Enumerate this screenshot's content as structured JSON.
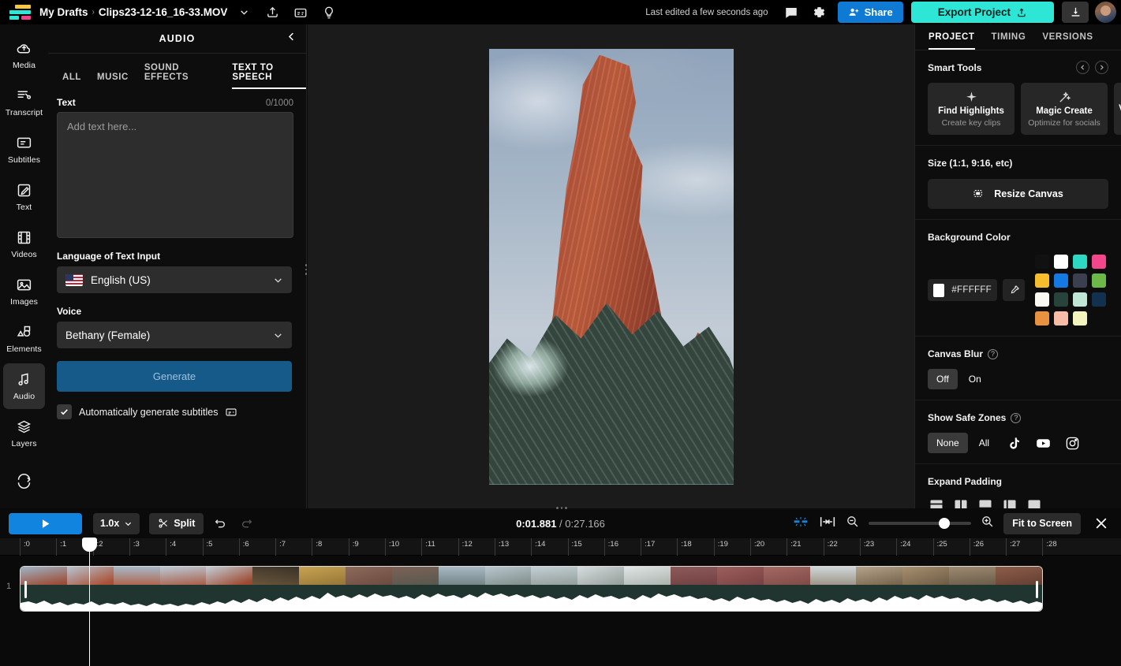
{
  "topbar": {
    "workspace": "My Drafts",
    "separator": "›",
    "filename": "Clips23-12-16_16-33.MOV",
    "last_edited": "Last edited a few seconds ago",
    "share_label": "Share",
    "export_label": "Export Project"
  },
  "rail": {
    "items": [
      {
        "label": "Media",
        "icon": "cloud-upload-icon",
        "active": false
      },
      {
        "label": "Transcript",
        "icon": "transcript-icon",
        "active": false
      },
      {
        "label": "Subtitles",
        "icon": "subtitles-icon",
        "active": false
      },
      {
        "label": "Text",
        "icon": "text-edit-icon",
        "active": false
      },
      {
        "label": "Videos",
        "icon": "film-icon",
        "active": false
      },
      {
        "label": "Images",
        "icon": "image-icon",
        "active": false
      },
      {
        "label": "Elements",
        "icon": "elements-icon",
        "active": false
      },
      {
        "label": "Audio",
        "icon": "music-note-icon",
        "active": true
      },
      {
        "label": "Layers",
        "icon": "layers-icon",
        "active": false
      },
      {
        "label": "",
        "icon": "loop-icon",
        "active": false
      }
    ]
  },
  "audio_panel": {
    "title": "AUDIO",
    "tabs": [
      {
        "label": "ALL",
        "active": false
      },
      {
        "label": "MUSIC",
        "active": false
      },
      {
        "label": "SOUND EFFECTS",
        "active": false
      },
      {
        "label": "TEXT TO SPEECH",
        "active": true
      }
    ],
    "text_label": "Text",
    "char_counter": "0/1000",
    "text_value": "",
    "text_placeholder": "Add text here...",
    "language_label": "Language of Text Input",
    "language_value": "English (US)",
    "voice_label": "Voice",
    "voice_value": "Bethany (Female)",
    "generate_label": "Generate",
    "auto_subtitles_label": "Automatically generate subtitles",
    "auto_subtitles_checked": true
  },
  "right_panel": {
    "tabs": [
      {
        "label": "PROJECT",
        "active": true
      },
      {
        "label": "TIMING",
        "active": false
      },
      {
        "label": "VERSIONS",
        "active": false
      }
    ],
    "smart_tools": {
      "title": "Smart Tools",
      "cards": [
        {
          "name": "Find Highlights",
          "sub": "Create key clips",
          "icon": "sparkle-icon"
        },
        {
          "name": "Magic Create",
          "sub": "Optimize for socials",
          "icon": "magic-wand-icon"
        },
        {
          "name": "V",
          "sub": "",
          "icon": "partial-card"
        }
      ]
    },
    "size": {
      "title": "Size (1:1, 9:16, etc)",
      "button_label": "Resize Canvas"
    },
    "background_color": {
      "title": "Background Color",
      "hex_value": "#FFFFFF",
      "swatches": [
        "#111111",
        "#FFFFFF",
        "#2ED9C3",
        "#F4478B",
        "#F6BE2C",
        "#1479E0",
        "#3B3F50",
        "#6CB94A",
        "#FBFAF2",
        "#27433B",
        "#BFE6D5",
        "#12314F",
        "#E8913F",
        "#F7BCA7",
        "#F2F3BD"
      ]
    },
    "canvas_blur": {
      "title": "Canvas Blur",
      "options": [
        {
          "label": "Off",
          "active": true
        },
        {
          "label": "On",
          "active": false
        }
      ]
    },
    "safe_zones": {
      "title": "Show Safe Zones",
      "options": [
        {
          "label": "None",
          "active": true,
          "icon": ""
        },
        {
          "label": "All",
          "active": false,
          "icon": ""
        },
        {
          "label": "",
          "active": false,
          "icon": "tiktok-icon"
        },
        {
          "label": "",
          "active": false,
          "icon": "youtube-icon"
        },
        {
          "label": "",
          "active": false,
          "icon": "instagram-icon"
        }
      ]
    },
    "expand_padding": {
      "title": "Expand Padding",
      "options": [
        "pad-top-icon",
        "pad-split-vertical-icon",
        "pad-bottom-icon",
        "pad-left-icon",
        "pad-none-icon"
      ]
    }
  },
  "timeline": {
    "speed": "1.0x",
    "split_label": "Split",
    "current_time": "0:01.881",
    "total_time": "0:27.166",
    "time_separator": " / ",
    "fit_label": "Fit to Screen",
    "track_number": "1",
    "ruler_ticks": [
      ":0",
      ":1",
      ":2",
      ":3",
      ":4",
      ":5",
      ":6",
      ":7",
      ":8",
      ":9",
      ":10",
      ":11",
      ":12",
      ":13",
      ":14",
      ":15",
      ":16",
      ":17",
      ":18",
      ":19",
      ":20",
      ":21",
      ":22",
      ":23",
      ":24",
      ":25",
      ":26",
      ":27",
      ":28"
    ]
  }
}
